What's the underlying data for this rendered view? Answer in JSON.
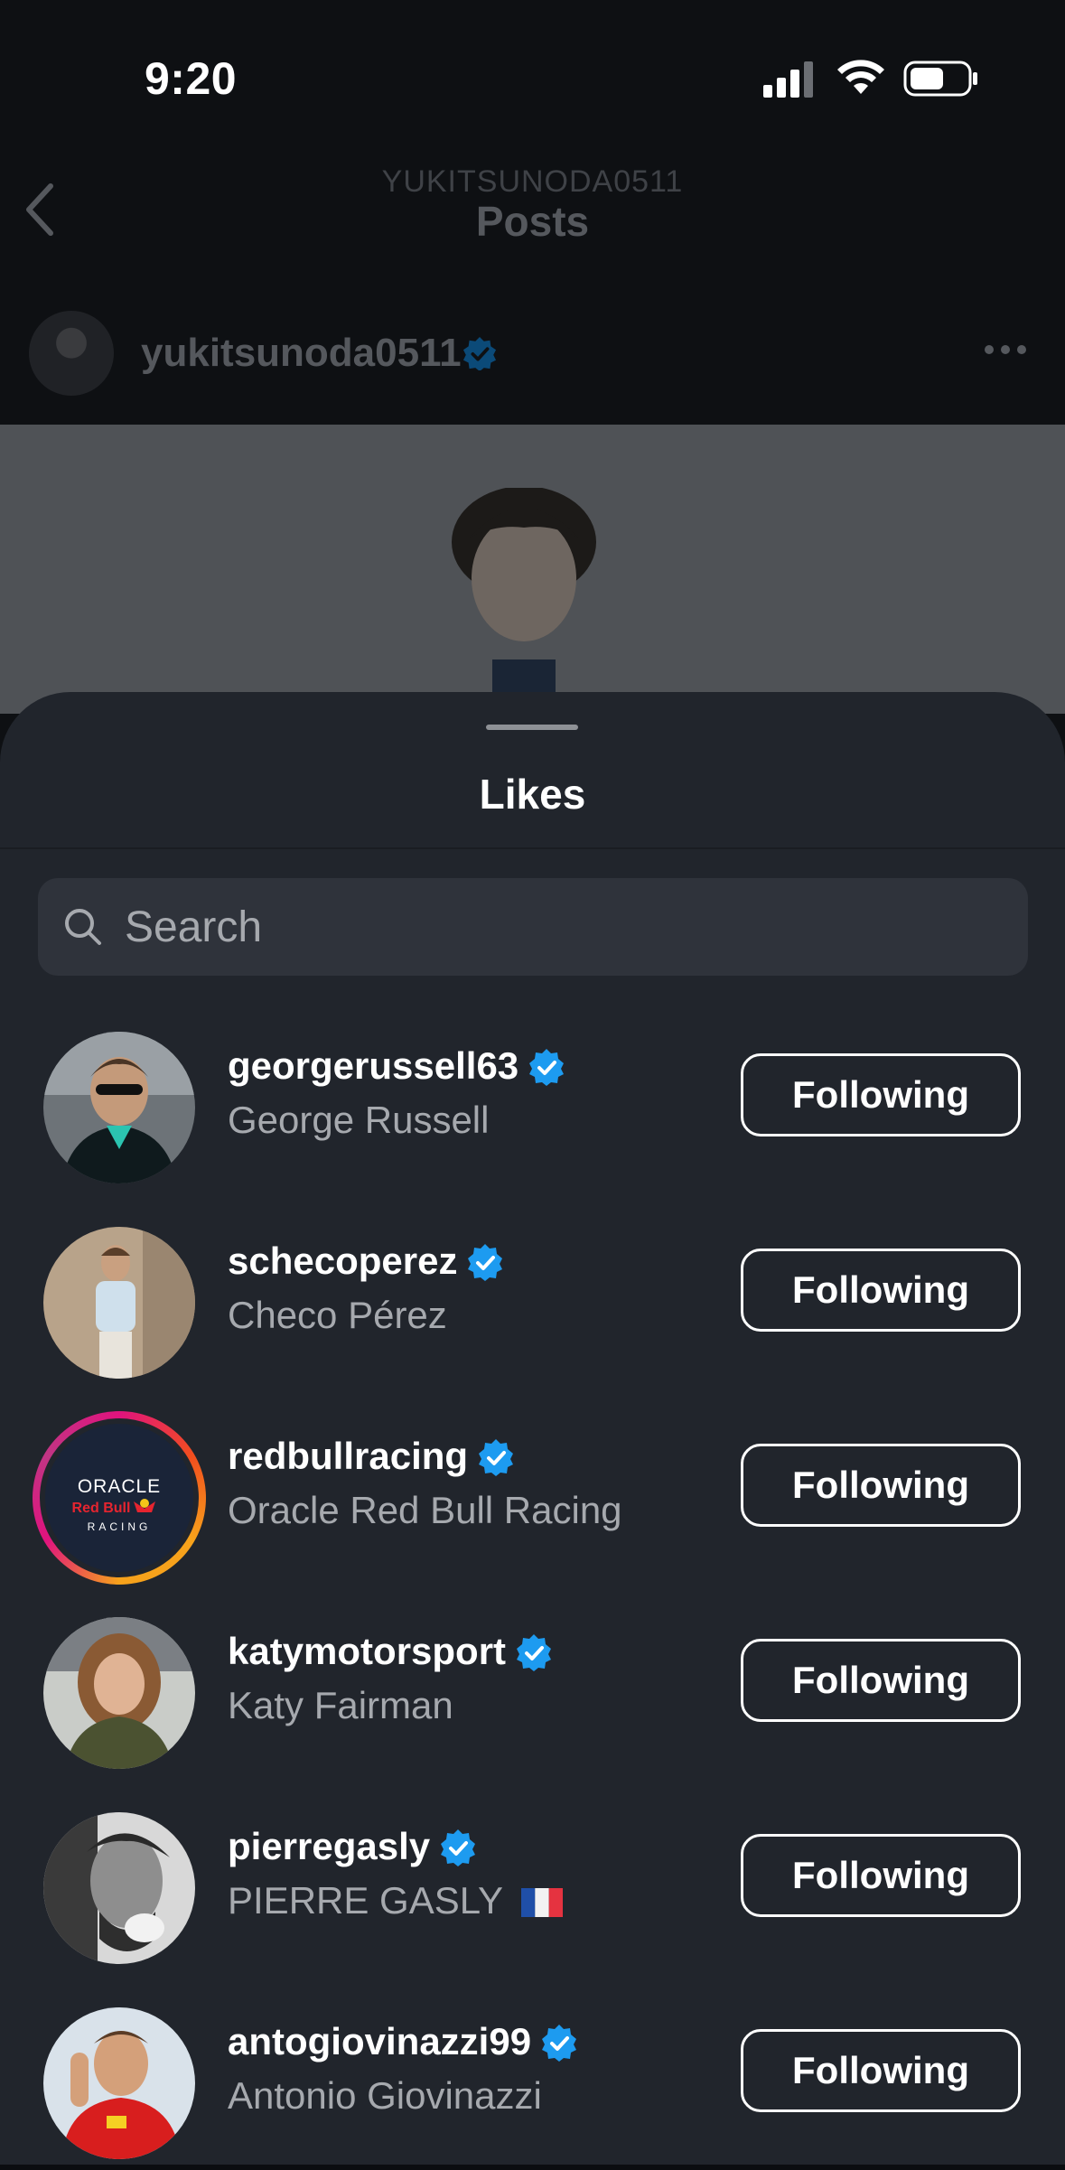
{
  "status_bar": {
    "time": "9:20"
  },
  "nav": {
    "subtitle": "YUKITSUNODA0511",
    "title": "Posts"
  },
  "post": {
    "username": "yukitsunoda0511"
  },
  "sheet": {
    "title": "Likes"
  },
  "search": {
    "placeholder": "Search"
  },
  "likes": [
    {
      "username": "georgerussell63",
      "full_name": "George Russell",
      "button": "Following",
      "story_ring": false
    },
    {
      "username": "schecoperez",
      "full_name": "Checo Pérez",
      "button": "Following",
      "story_ring": false
    },
    {
      "username": "redbullracing",
      "full_name": "Oracle Red Bull Racing",
      "button": "Following",
      "story_ring": true,
      "logo_text": [
        "ORACLE",
        "Red Bull",
        "RACING"
      ]
    },
    {
      "username": "katymotorsport",
      "full_name": "Katy Fairman",
      "button": "Following",
      "story_ring": false
    },
    {
      "username": "pierregasly",
      "full_name": "PIERRE GASLY",
      "button": "Following",
      "story_ring": false
    },
    {
      "username": "antogiovinazzi99",
      "full_name": "Antonio Giovinazzi",
      "button": "Following",
      "story_ring": false
    }
  ],
  "colors": {
    "verified": "#1d9bf0",
    "sheet_bg": "#21252c",
    "search_bg": "#2f333b",
    "secondary_text": "#a6a9ae"
  }
}
